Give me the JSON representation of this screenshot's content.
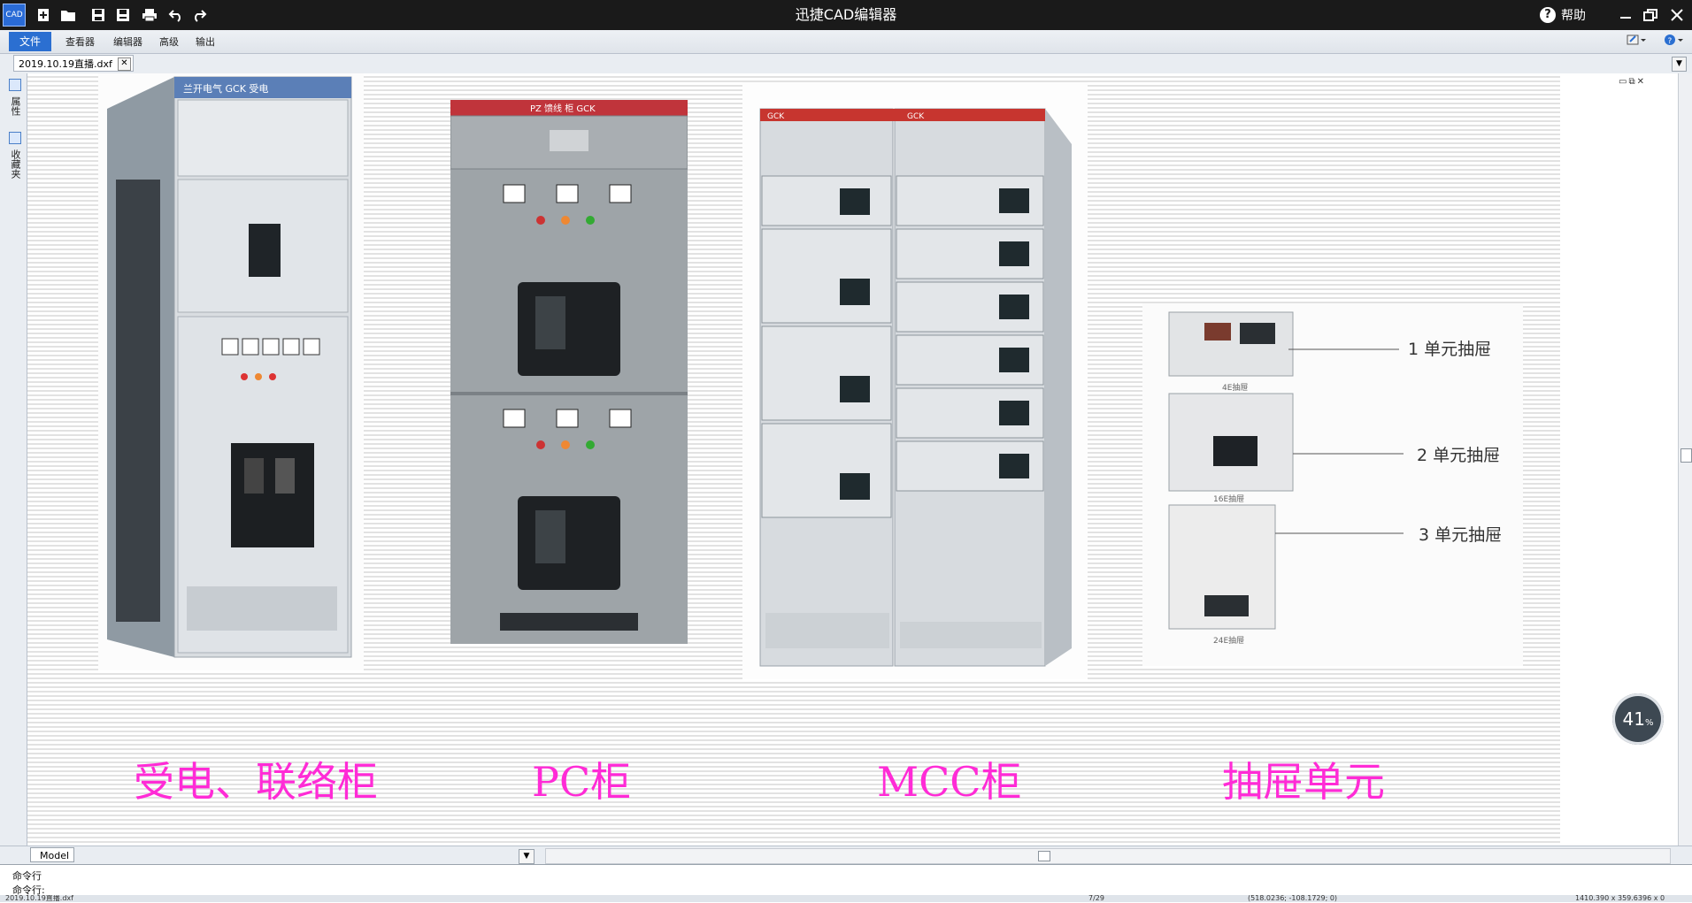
{
  "window": {
    "title": "迅捷CAD编辑器",
    "help_label": "帮助"
  },
  "menu": {
    "file": "文件",
    "viewer": "查看器",
    "editor": "编辑器",
    "advanced": "高级",
    "output": "输出"
  },
  "document": {
    "tab_label": "2019.10.19直播.dxf"
  },
  "sidebar": {
    "properties_label": "属性",
    "favorites_label": "收藏夹"
  },
  "canvas": {
    "labels": [
      "受电、联络柜",
      "PC柜",
      "MCC柜",
      "抽屉单元"
    ],
    "callouts": [
      "1 单元抽屉",
      "2 单元抽屉",
      "3 单元抽屉"
    ],
    "cabinet1_header": "兰开电气   GCK   受电",
    "cabinet2_header": "PZ 馈线 柜 GCK",
    "cabinet3_header_left": "GCK",
    "cabinet3_header_right": "GCK",
    "drawer_captions": [
      "4E抽屉",
      "16E抽屉",
      "24E抽屉"
    ],
    "progress_value": "41",
    "progress_unit": "%"
  },
  "layout_tabs": {
    "model": "Model"
  },
  "command": {
    "line1": "命令行",
    "line2": "命令行:"
  },
  "status": {
    "file": "2019.10.19直播.dxf",
    "page": "7/29",
    "coords": "(518.0236; -108.1729; 0)",
    "size": "1410.390 x 359.6396 x 0"
  },
  "colors": {
    "accent": "#2b6fd1",
    "label_magenta": "#ff2bd6",
    "titlebar": "#1a1a1a"
  }
}
